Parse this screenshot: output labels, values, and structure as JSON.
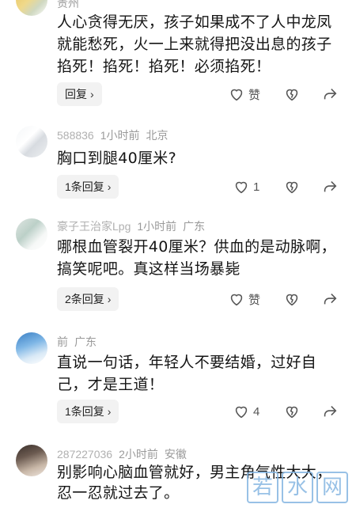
{
  "comments": [
    {
      "meta": {
        "name": "",
        "time": "",
        "location": "贵州"
      },
      "text": "人心贪得无厌，孩子如果成不了人中龙凤就能愁死，火一上来就得把没出息的孩子掐死！掐死！掐死！必须掐死！",
      "reply_label": "回复",
      "like_label": "赞",
      "like_count": null
    },
    {
      "meta": {
        "name": "588836",
        "time": "1小时前",
        "location": "北京"
      },
      "text": "胸口到腿40厘米?",
      "reply_label": "1条回复",
      "like_label": "1"
    },
    {
      "meta": {
        "name": "豪子王治家Lpg",
        "time": "1小时前",
        "location": "广东"
      },
      "text": "哪根血管裂开40厘米？供血的是动脉啊，搞笑呢吧。真这样当场暴毙",
      "reply_label": "2条回复",
      "like_label": "赞"
    },
    {
      "meta": {
        "name": "",
        "time": "前",
        "location": "广东"
      },
      "text": "直说一句话，年轻人不要结婚，过好自己，才是王道！",
      "reply_label": "1条回复",
      "like_label": "4"
    },
    {
      "meta": {
        "name": "287227036",
        "time": "2小时前",
        "location": "安徽"
      },
      "text": "别影响心脑血管就好，男主角气性大大，忍一忍就过去了。",
      "reply_label": "",
      "like_label": ""
    }
  ],
  "watermark": [
    "若",
    "水",
    "网"
  ],
  "colors": {
    "reply_bg": "#f2f2f2",
    "meta": "#9a9a9a",
    "watermark": "#7fb2e0"
  }
}
